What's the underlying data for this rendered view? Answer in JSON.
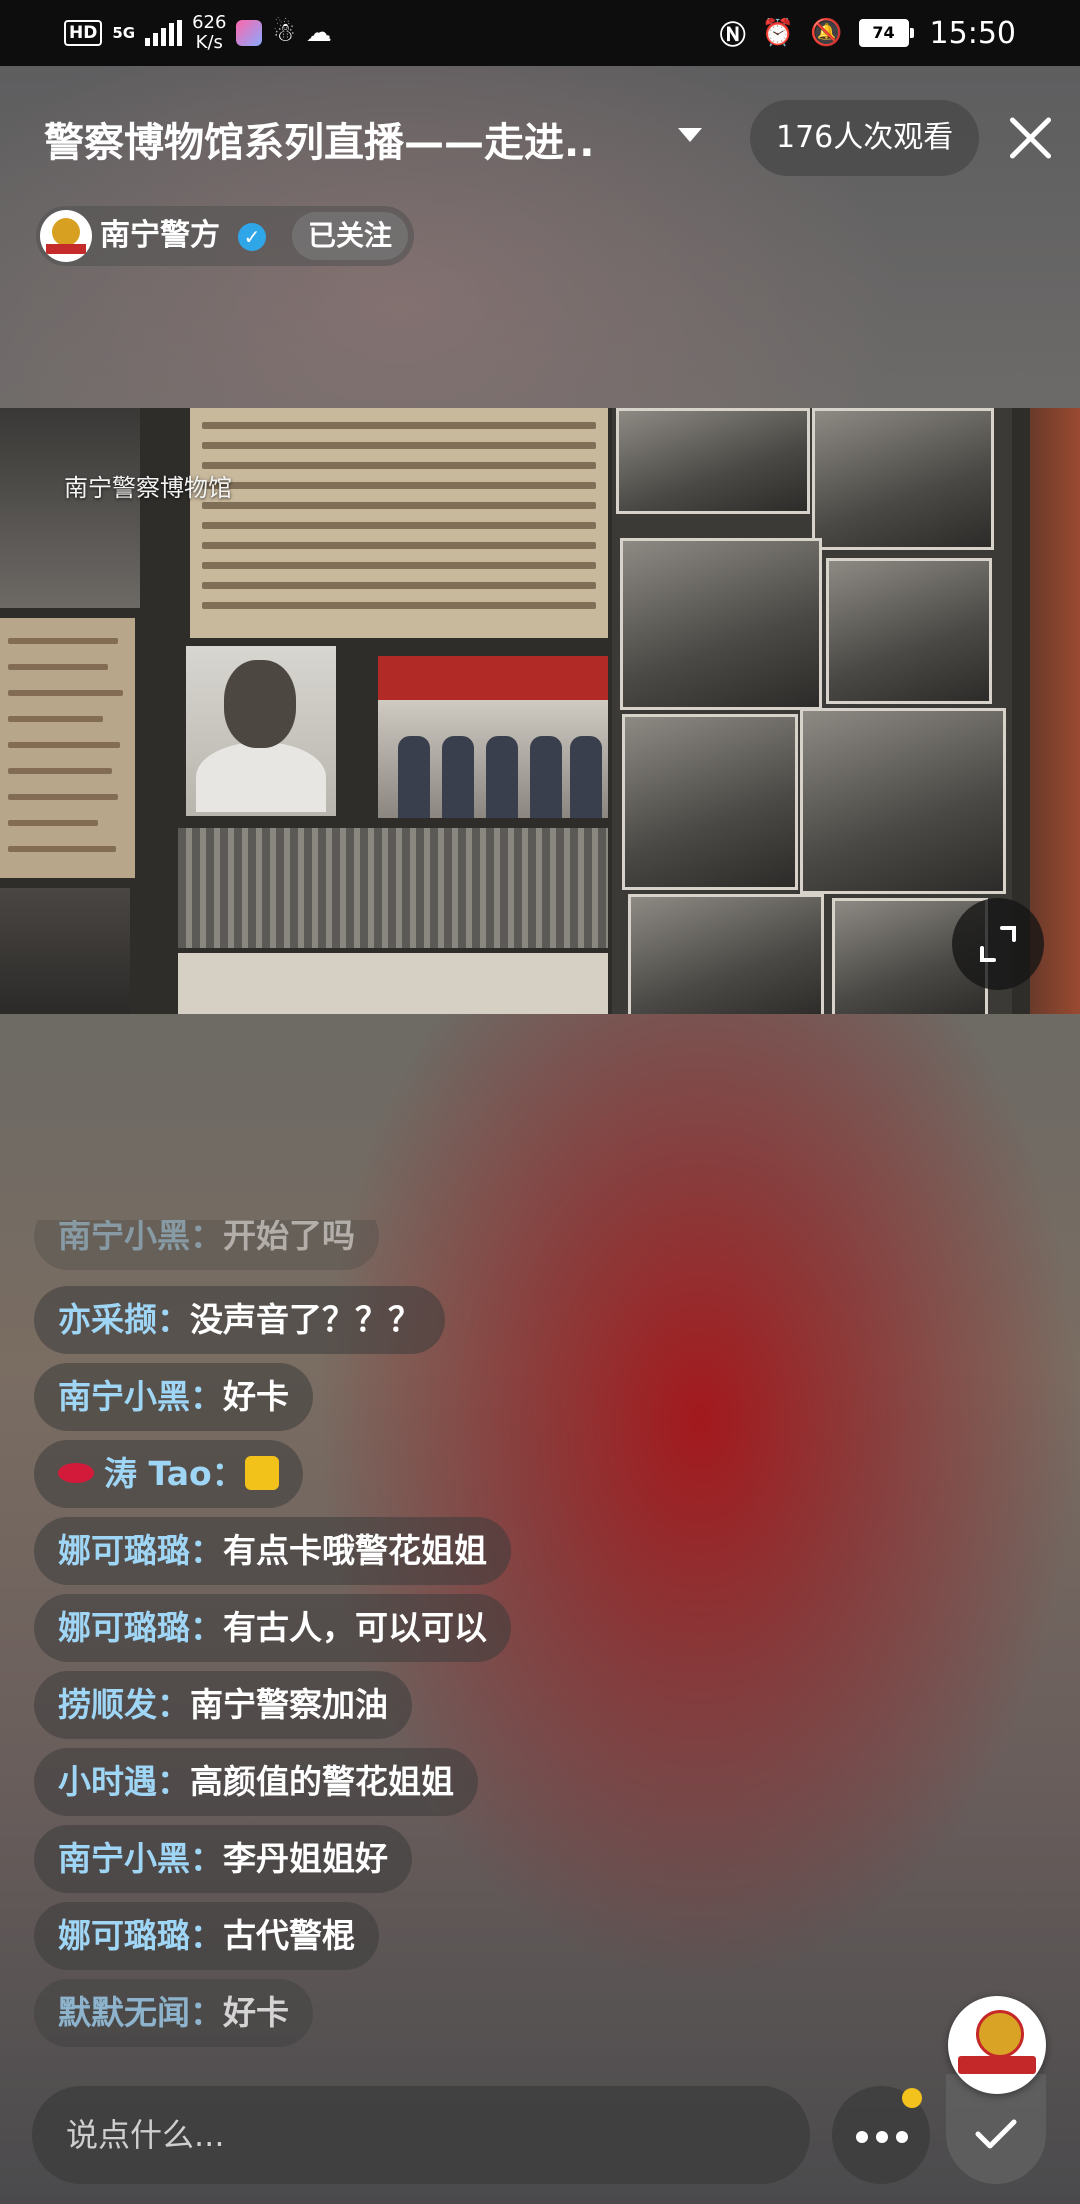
{
  "status_bar": {
    "hd": "HD",
    "network": "5G",
    "speed_value": "626",
    "speed_unit": "K/s",
    "battery": "74",
    "time": "15:50"
  },
  "header": {
    "title": "警察博物馆系列直播——走进..",
    "viewers": "176人次观看"
  },
  "anchor": {
    "name": "南宁警方",
    "follow_label": "已关注"
  },
  "video": {
    "caption": "南宁警察博物馆"
  },
  "comments": [
    {
      "user": "南宁小黑：",
      "text": "开始了吗"
    },
    {
      "user": "亦采撷：",
      "text": "没声音了？？？"
    },
    {
      "user": "南宁小黑：",
      "text": "好卡"
    },
    {
      "user": "涛 Tao：",
      "text": ""
    },
    {
      "user": "娜可璐璐：",
      "text": "有点卡哦警花姐姐"
    },
    {
      "user": "娜可璐璐：",
      "text": "有古人，可以可以"
    },
    {
      "user": "捞顺发：",
      "text": "南宁警察加油"
    },
    {
      "user": "小时遇：",
      "text": "高颜值的警花姐姐"
    },
    {
      "user": "南宁小黑：",
      "text": "李丹姐姐好"
    },
    {
      "user": "娜可璐璐：",
      "text": "古代警棍"
    },
    {
      "user": "默默无闻：",
      "text": "好卡"
    }
  ],
  "input": {
    "placeholder": "说点什么..."
  },
  "colors": {
    "username": "#9fd5f5",
    "verified": "#2fa6e8",
    "badge": "#f4c21d"
  },
  "icons": [
    "hd-icon",
    "signal-icon",
    "nfc-icon",
    "alarm-icon",
    "mute-icon",
    "battery-icon",
    "caret-down-icon",
    "close-icon",
    "verified-icon",
    "fullscreen-icon",
    "more-icon",
    "check-icon"
  ]
}
